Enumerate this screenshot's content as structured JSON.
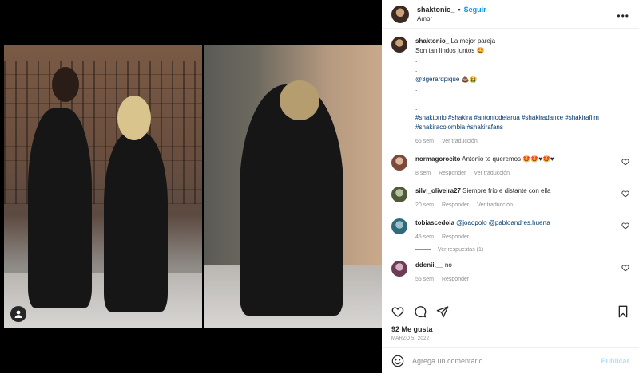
{
  "post": {
    "author": "shaktonio_",
    "follow_label": "Seguir",
    "dot": "•",
    "location": "Amor",
    "more_label": "•••"
  },
  "caption": {
    "username": "shaktonio_",
    "line1": "La mejor pareja",
    "line2": "Son tan lindos juntos 🤩",
    "dots1": ".",
    "dots2": ".",
    "mention": "@3gerardpique",
    "mention_emoji": "💩🤮",
    "dots3": ".",
    "dots4": ".",
    "dots5": ".",
    "hashtags": "#shaktonio #shakira #antoniodelarua #shakiradance #shakirafilm #shakiracolombia #shakirafans",
    "time": "66 sem",
    "translate": "Ver traducción"
  },
  "comments": [
    {
      "username": "normagorocito",
      "text": "Antonio te queremos 🤩🤩♥🤩♥",
      "time": "8 sem",
      "reply": "Responder",
      "translate": "Ver traducción"
    },
    {
      "username": "silvi_oliveira27",
      "text": "Siempre frío e distante con ella",
      "time": "20 sem",
      "reply": "Responder",
      "translate": "Ver traducción"
    },
    {
      "username": "tobiascedola",
      "text_tag1": "@joaqpolo",
      "text_tag2": "@pabloandres.huerta",
      "time": "45 sem",
      "reply": "Responder",
      "view_replies": "Ver respuestas (1)"
    },
    {
      "username": "ddenii.__",
      "text": "no",
      "time": "55 sem",
      "reply": "Responder"
    }
  ],
  "actions": {
    "likes": "92 Me gusta",
    "date": "MARZO 5, 2022"
  },
  "compose": {
    "placeholder": "Agrega un comentario...",
    "publish": "Publicar"
  },
  "icons": {
    "like": "heart-icon",
    "comment": "comment-icon",
    "share": "paper-plane-icon",
    "save": "bookmark-icon",
    "emoji": "smiley-icon",
    "user_tag": "user-icon"
  },
  "colors": {
    "accent": "#0095f6",
    "link": "#00376b",
    "muted": "#8e8e8e",
    "publish_disabled": "#b2dffc"
  }
}
